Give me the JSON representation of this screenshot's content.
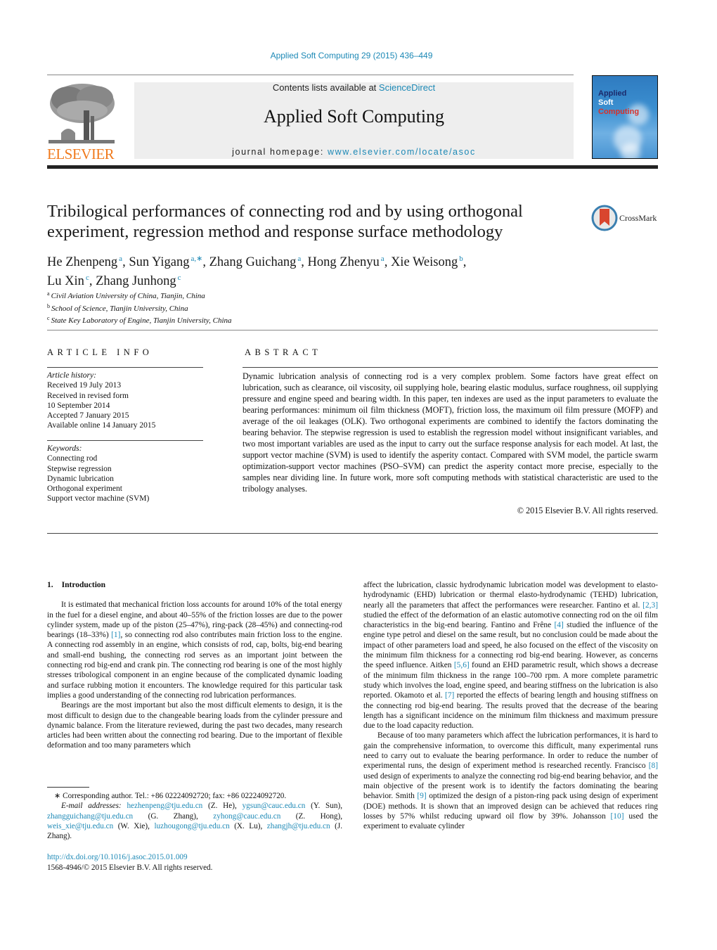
{
  "header": {
    "citation": "Applied Soft Computing 29 (2015) 436–449",
    "contents_prefix": "Contents lists available at ",
    "contents_link": "ScienceDirect",
    "journal_name": "Applied Soft Computing",
    "homepage_prefix": "journal homepage: ",
    "homepage_link": "www.elsevier.com/locate/asoc",
    "publisher_logo_text": "ELSEVIER",
    "cover": {
      "line1": "Applied",
      "line2": "Soft",
      "line3": "Computing"
    },
    "colors": {
      "link": "#1d89b6",
      "elsevier_orange": "#f07a1d"
    }
  },
  "article": {
    "title_line1": "Tribilogical performances of connecting rod and by using orthogonal",
    "title_line2": "experiment, regression method and response surface methodology",
    "crossmark_label": "CrossMark",
    "authors": [
      {
        "name": "He Zhenpeng",
        "aff": "a",
        "sep": ", "
      },
      {
        "name": "Sun Yigang",
        "aff": "a,∗",
        "sep": ", "
      },
      {
        "name": "Zhang Guichang",
        "aff": "a",
        "sep": ", "
      },
      {
        "name": "Hong Zhenyu",
        "aff": "a",
        "sep": ", "
      },
      {
        "name": "Xie Weisong",
        "aff": "b",
        "sep": ","
      },
      {
        "name": "Lu Xin",
        "aff": "c",
        "sep": ", "
      },
      {
        "name": "Zhang Junhong",
        "aff": "c",
        "sep": ""
      }
    ],
    "affiliations": [
      {
        "key": "a",
        "text": "Civil Aviation University of China, Tianjin, China"
      },
      {
        "key": "b",
        "text": "School of Science, Tianjin University, China"
      },
      {
        "key": "c",
        "text": "State Key Laboratory of Engine, Tianjin University, China"
      }
    ]
  },
  "article_info": {
    "heading": "ARTICLE INFO",
    "history_label": "Article history:",
    "history": [
      "Received 19 July 2013",
      "Received in revised form",
      "10 September 2014",
      "Accepted 7 January 2015",
      "Available online 14 January 2015"
    ],
    "keywords_label": "Keywords:",
    "keywords": [
      "Connecting rod",
      "Stepwise regression",
      "Dynamic lubrication",
      "Orthogonal experiment",
      "Support vector machine (SVM)"
    ]
  },
  "abstract": {
    "heading": "ABSTRACT",
    "text": "Dynamic lubrication analysis of connecting rod is a very complex problem. Some factors have great effect on lubrication, such as clearance, oil viscosity, oil supplying hole, bearing elastic modulus, surface roughness, oil supplying pressure and engine speed and bearing width. In this paper, ten indexes are used as the input parameters to evaluate the bearing performances: minimum oil film thickness (MOFT), friction loss, the maximum oil film pressure (MOFP) and average of the oil leakages (OLK). Two orthogonal experiments are combined to identify the factors dominating the bearing behavior. The stepwise regression is used to establish the regression model without insignificant variables, and two most important variables are used as the input to carry out the surface response analysis for each model. At last, the support vector machine (SVM) is used to identify the asperity contact. Compared with SVM model, the particle swarm optimization-support vector machines (PSO–SVM) can predict the asperity contact more precise, especially to the samples near dividing line. In future work, more soft computing methods with statistical characteristic are used to the tribology analyses.",
    "copyright": "© 2015 Elsevier B.V. All rights reserved."
  },
  "body": {
    "section_number": "1.",
    "section_title": "Introduction",
    "left_paragraphs": [
      {
        "parts": [
          {
            "t": "It is estimated that mechanical friction loss accounts for around 10% of the total energy in the fuel for a diesel engine, and about 40–55% of the friction losses are due to the power cylinder system, made up of the piston (25–47%), ring-pack (28–45%) and connecting-rod bearings (18–33%) "
          },
          {
            "t": "[1]",
            "link": true
          },
          {
            "t": ", so connecting rod also contributes main friction loss to the engine. A connecting rod assembly in an engine, which consists of rod, cap, bolts, big-end bearing and small-end bushing, the connecting rod serves as an important joint between the connecting rod big-end and crank pin. The connecting rod bearing is one of the most highly stresses tribological component in an engine because of the complicated dynamic loading and surface rubbing motion it encounters. The knowledge required for this particular task implies a good understanding of the connecting rod lubrication performances."
          }
        ]
      },
      {
        "parts": [
          {
            "t": "Bearings are the most important but also the most difficult elements to design, it is the most difficult to design due to the changeable bearing loads from the cylinder pressure and dynamic balance. From the literature reviewed, during the past two decades, many research articles had been written about the connecting rod bearing. Due to the important of flexible deformation and too many parameters which"
          }
        ]
      }
    ],
    "right_paragraphs": [
      {
        "noindent": true,
        "parts": [
          {
            "t": "affect the lubrication, classic hydrodynamic lubrication model was development to elasto-hydrodynamic (EHD) lubrication or thermal elasto-hydrodynamic (TEHD) lubrication, nearly all the parameters that affect the performances were researcher. Fantino et al. "
          },
          {
            "t": "[2,3]",
            "link": true
          },
          {
            "t": " studied the effect of the deformation of an elastic automotive connecting rod on the oil film characteristics in the big-end bearing. Fantino and Frêne "
          },
          {
            "t": "[4]",
            "link": true
          },
          {
            "t": " studied the influence of the engine type petrol and diesel on the same result, but no conclusion could be made about the impact of other parameters load and speed, he also focused on the effect of the viscosity on the minimum film thickness for a connecting rod big-end bearing. However, as concerns the speed influence. Aitken "
          },
          {
            "t": "[5,6]",
            "link": true
          },
          {
            "t": " found an EHD parametric result, which shows a decrease of the minimum film thickness in the range 100–700 rpm. A more complete parametric study which involves the load, engine speed, and bearing stiffness on the lubrication is also reported. Okamoto et al. "
          },
          {
            "t": "[7]",
            "link": true
          },
          {
            "t": " reported the effects of bearing length and housing stiffness on the connecting rod big-end bearing. The results proved that the decrease of the bearing length has a significant incidence on the minimum film thickness and maximum pressure due to the load capacity reduction."
          }
        ]
      },
      {
        "parts": [
          {
            "t": "Because of too many parameters which affect the lubrication performances, it is hard to gain the comprehensive information, to overcome this difficult, many experimental runs need to carry out to evaluate the bearing performance. In order to reduce the number of experimental runs, the design of experiment method is researched recently. Francisco "
          },
          {
            "t": "[8]",
            "link": true
          },
          {
            "t": " used design of experiments to analyze the connecting rod big-end bearing behavior, and the main objective of the present work is to identify the factors dominating the bearing behavior. Smith "
          },
          {
            "t": "[9]",
            "link": true
          },
          {
            "t": " optimized the design of a piston-ring pack using design of experiment (DOE) methods. It is shown that an improved design can be achieved that reduces ring losses by 57% whilst reducing upward oil flow by 39%. Johansson "
          },
          {
            "t": "[10]",
            "link": true
          },
          {
            "t": " used the experiment to evaluate cylinder"
          }
        ]
      }
    ]
  },
  "footnotes": {
    "corresponding": "∗  Corresponding author. Tel.: +86 02224092720; fax: +86 02224092720.",
    "email_label": "E-mail addresses:",
    "emails": [
      {
        "addr": "hezhenpeng@tju.edu.cn",
        "who": " (Z. He), "
      },
      {
        "addr": "ygsun@cauc.edu.cn",
        "who": " (Y. Sun), "
      },
      {
        "addr": "zhangguichang@tju.edu.cn",
        "who": " (G. Zhang), "
      },
      {
        "addr": "zyhong@cauc.edu.cn",
        "who": " (Z. Hong), "
      },
      {
        "addr": "weis_xie@tju.edu.cn",
        "who": " (W. Xie), "
      },
      {
        "addr": "luzhougong@tju.edu.cn",
        "who": " (X. Lu), "
      },
      {
        "addr": "zhangjh@tju.edu.cn",
        "who": " (J. Zhang)."
      }
    ],
    "doi": "http://dx.doi.org/10.1016/j.asoc.2015.01.009",
    "issn_line": "1568-4946/© 2015 Elsevier B.V. All rights reserved."
  }
}
